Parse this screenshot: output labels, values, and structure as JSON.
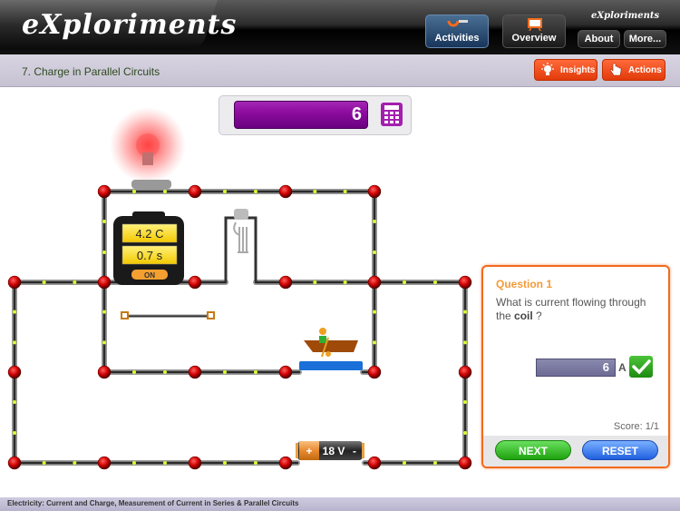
{
  "app": {
    "logo_text": "eXploriments",
    "mini_logo_text": "eXploriments"
  },
  "nav": {
    "activities_label": "Activities",
    "overview_label": "Overview",
    "about_label": "About",
    "more_label": "More..."
  },
  "subheader": {
    "title": "7. Charge in Parallel Circuits",
    "insights_label": "Insights",
    "actions_label": "Actions"
  },
  "display": {
    "value": "6"
  },
  "circuit": {
    "meter_charge": "4.2 C",
    "meter_time": "0.7 s",
    "meter_switch": "ON",
    "battery_label": "18 V",
    "battery_plus": "+",
    "battery_minus": "-"
  },
  "question": {
    "title": "Question 1",
    "text_prefix": "What is current flowing through the ",
    "text_bold": "coil",
    "text_suffix": " ?",
    "answer_value": "6",
    "unit": "A",
    "score": "Score: 1/1",
    "next_label": "NEXT",
    "reset_label": "RESET"
  },
  "footer": {
    "text": "Electricity: Current and Charge, Measurement of Current in Series & Parallel Circuits"
  }
}
